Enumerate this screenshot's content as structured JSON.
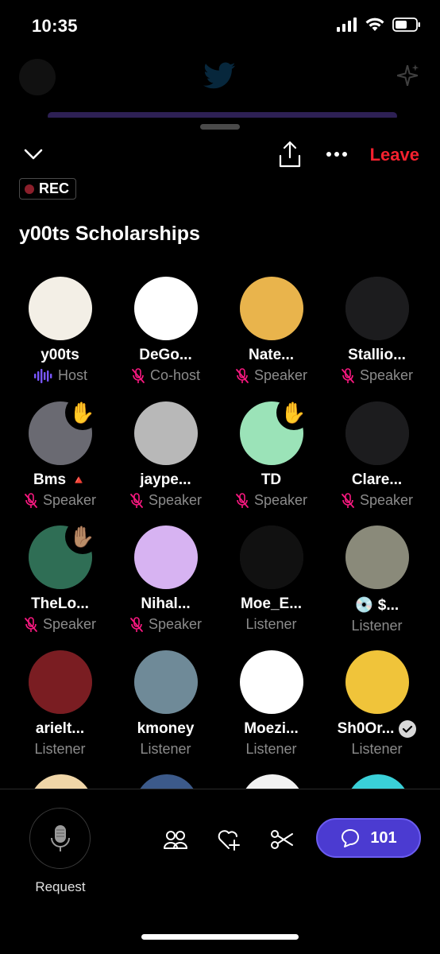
{
  "status_bar": {
    "time": "10:35"
  },
  "topbar": {
    "leave_label": "Leave",
    "rec_label": "REC"
  },
  "space": {
    "title": "y00ts Scholarships"
  },
  "participants": [
    {
      "name": "y00ts",
      "role": "Host",
      "role_icon": "audio-wave-icon",
      "hand": false,
      "verified": false,
      "flag": "",
      "avatar_color": "#f3efe6"
    },
    {
      "name": "DeGo...",
      "role": "Co-host",
      "role_icon": "mic-muted-icon",
      "hand": false,
      "verified": false,
      "flag": "",
      "avatar_color": "#ffffff"
    },
    {
      "name": "Nate...",
      "role": "Speaker",
      "role_icon": "mic-muted-icon",
      "hand": false,
      "verified": false,
      "flag": "",
      "avatar_color": "#e9b44c"
    },
    {
      "name": "Stallio...",
      "role": "Speaker",
      "role_icon": "mic-muted-icon",
      "hand": false,
      "verified": false,
      "flag": "",
      "avatar_color": "#1c1c1e"
    },
    {
      "name": "Bms",
      "role": "Speaker",
      "role_icon": "mic-muted-icon",
      "hand": true,
      "hand_glyph": "✋",
      "verified": false,
      "flag": "🔺",
      "avatar_color": "#6a6a72"
    },
    {
      "name": "jaype...",
      "role": "Speaker",
      "role_icon": "mic-muted-icon",
      "hand": false,
      "verified": false,
      "flag": "",
      "avatar_color": "#b8b8b8"
    },
    {
      "name": "TD",
      "role": "Speaker",
      "role_icon": "mic-muted-icon",
      "hand": true,
      "hand_glyph": "✋",
      "verified": false,
      "flag": "",
      "avatar_color": "#9be3b8"
    },
    {
      "name": "Clare...",
      "role": "Speaker",
      "role_icon": "mic-muted-icon",
      "hand": false,
      "verified": false,
      "flag": "",
      "avatar_color": "#1c1c1e"
    },
    {
      "name": "TheLo...",
      "role": "Speaker",
      "role_icon": "mic-muted-icon",
      "hand": true,
      "hand_glyph": "✋🏽",
      "verified": false,
      "flag": "",
      "avatar_color": "#2f6e55"
    },
    {
      "name": "Nihal...",
      "role": "Speaker",
      "role_icon": "mic-muted-icon",
      "hand": false,
      "verified": false,
      "flag": "",
      "avatar_color": "#d7b3f2"
    },
    {
      "name": "Moe_E...",
      "role": "Listener",
      "role_icon": "",
      "hand": false,
      "verified": false,
      "flag": "",
      "avatar_color": "#111111"
    },
    {
      "name": "💿 $...",
      "role": "Listener",
      "role_icon": "",
      "hand": false,
      "verified": false,
      "flag": "",
      "avatar_color": "#8a8a7a"
    },
    {
      "name": "arielt...",
      "role": "Listener",
      "role_icon": "",
      "hand": false,
      "verified": false,
      "flag": "",
      "avatar_color": "#7a1d22"
    },
    {
      "name": "kmoney",
      "role": "Listener",
      "role_icon": "",
      "hand": false,
      "verified": false,
      "flag": "",
      "avatar_color": "#6f8a98"
    },
    {
      "name": "Moezi...",
      "role": "Listener",
      "role_icon": "",
      "hand": false,
      "verified": false,
      "flag": "",
      "avatar_color": "#ffffff"
    },
    {
      "name": "Sh0Or...",
      "role": "Listener",
      "role_icon": "",
      "hand": false,
      "verified": true,
      "flag": "",
      "avatar_color": "#f0c43a"
    }
  ],
  "bottom_bar": {
    "request_label": "Request",
    "comment_count": "101",
    "icons": [
      "people-icon",
      "heart-plus-icon",
      "scissors-icon",
      "comment-icon"
    ]
  },
  "colors": {
    "leave": "#f4212e",
    "comment_button": "#4b3bd1",
    "muted_mic": "#f91880",
    "host_wave": "#7856ff"
  }
}
